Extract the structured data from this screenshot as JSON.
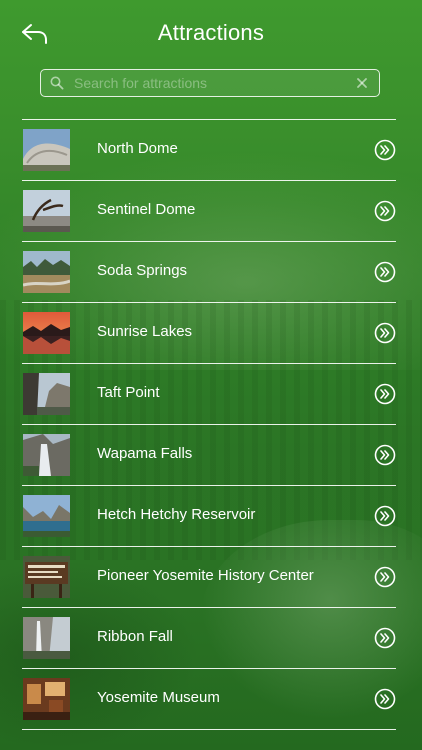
{
  "header": {
    "title": "Attractions",
    "back_icon": "back-arrow-icon"
  },
  "search": {
    "placeholder": "Search for attractions",
    "value": "",
    "search_icon": "search-icon",
    "clear_icon": "clear-icon"
  },
  "colors": {
    "background": "#2f7f27",
    "text": "#ffffff",
    "divider": "#ffffff"
  },
  "attractions": [
    {
      "label": "North Dome",
      "thumb_icon": "granite-dome-photo",
      "chevron_icon": "chevron-right-circle-icon"
    },
    {
      "label": "Sentinel Dome",
      "thumb_icon": "tree-on-rock-photo",
      "chevron_icon": "chevron-right-circle-icon"
    },
    {
      "label": "Soda Springs",
      "thumb_icon": "meadow-stream-photo",
      "chevron_icon": "chevron-right-circle-icon"
    },
    {
      "label": "Sunrise Lakes",
      "thumb_icon": "sunset-lake-photo",
      "chevron_icon": "chevron-right-circle-icon"
    },
    {
      "label": "Taft Point",
      "thumb_icon": "cliff-photo",
      "chevron_icon": "chevron-right-circle-icon"
    },
    {
      "label": "Wapama Falls",
      "thumb_icon": "waterfall-photo",
      "chevron_icon": "chevron-right-circle-icon"
    },
    {
      "label": "Hetch Hetchy Reservoir",
      "thumb_icon": "reservoir-photo",
      "chevron_icon": "chevron-right-circle-icon"
    },
    {
      "label": "Pioneer Yosemite History Center",
      "thumb_icon": "history-sign-photo",
      "chevron_icon": "chevron-right-circle-icon"
    },
    {
      "label": "Ribbon Fall",
      "thumb_icon": "ribbon-fall-photo",
      "chevron_icon": "chevron-right-circle-icon"
    },
    {
      "label": "Yosemite Museum",
      "thumb_icon": "museum-interior-photo",
      "chevron_icon": "chevron-right-circle-icon"
    }
  ]
}
